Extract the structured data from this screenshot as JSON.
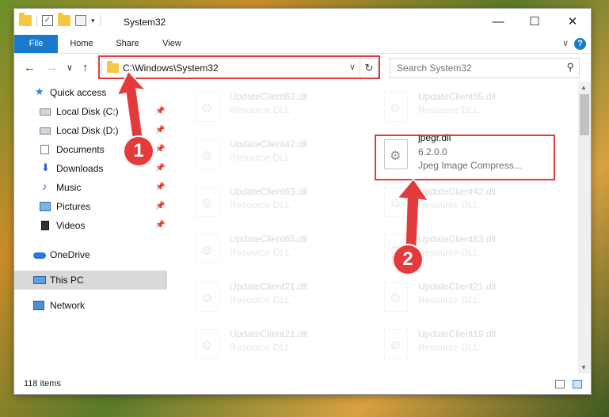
{
  "window": {
    "title": "System32",
    "controls": {
      "minimize": "—",
      "maximize": "☐",
      "close": "✕"
    }
  },
  "ribbon": {
    "tabs": [
      "File",
      "Home",
      "Share",
      "View"
    ],
    "help": "?",
    "collapse": "∨"
  },
  "navigation": {
    "back": "←",
    "forward": "→",
    "recent": "∨",
    "up": "↑",
    "address": "C:\\Windows\\System32",
    "address_dropdown": "∨",
    "refresh": "↻",
    "search_placeholder": "Search System32",
    "search_icon": "⚲"
  },
  "sidebar": {
    "items": [
      {
        "label": "Quick access",
        "icon": "star-icon"
      },
      {
        "label": "Local Disk (C:)",
        "icon": "drive-icon",
        "pinned": true
      },
      {
        "label": "Local Disk (D:)",
        "icon": "drive-icon",
        "pinned": true
      },
      {
        "label": "Documents",
        "icon": "documents-icon",
        "pinned": true
      },
      {
        "label": "Downloads",
        "icon": "download-icon",
        "pinned": true
      },
      {
        "label": "Music",
        "icon": "music-icon",
        "pinned": true
      },
      {
        "label": "Pictures",
        "icon": "pictures-icon",
        "pinned": true
      },
      {
        "label": "Videos",
        "icon": "videos-icon",
        "pinned": true
      },
      {
        "label": "OneDrive",
        "icon": "cloud-icon"
      },
      {
        "label": "This PC",
        "icon": "computer-icon",
        "selected": true
      },
      {
        "label": "Network",
        "icon": "network-icon"
      }
    ],
    "pin_glyph": "📌"
  },
  "files": {
    "left_column": [
      {
        "name": "UpdateClient63.dll",
        "type": "Resource DLL"
      },
      {
        "name": "UpdateClient42.dll",
        "type": "Resource DLL"
      },
      {
        "name": "UpdateClient63.dll",
        "type": "Resource DLL"
      },
      {
        "name": "UpdateClient65.dll",
        "type": "Resource DLL"
      },
      {
        "name": "UpdateClient21.dll",
        "type": "Resource DLL"
      },
      {
        "name": "UpdateClient21.dll",
        "type": "Resource DLL"
      }
    ],
    "right_column": [
      {
        "name": "UpdateClient65.dll",
        "type": "Resource DLL"
      },
      {
        "name": "jpegr.dll",
        "type": "6.2.0.0",
        "description": "Jpeg Image Compress...",
        "highlighted": true
      },
      {
        "name": "UpdateClient42.dll",
        "type": "Resource DLL"
      },
      {
        "name": "UpdateClient63.dll",
        "type": "Resource DLL"
      },
      {
        "name": "UpdateClient21.dll",
        "type": "Resource DLL"
      },
      {
        "name": "UpdateClient19.dll",
        "type": "Resource DLL"
      }
    ]
  },
  "status": {
    "item_count": "118 items"
  },
  "annotations": {
    "callout_1": "1",
    "callout_2": "2",
    "color": "#e33b3b"
  }
}
